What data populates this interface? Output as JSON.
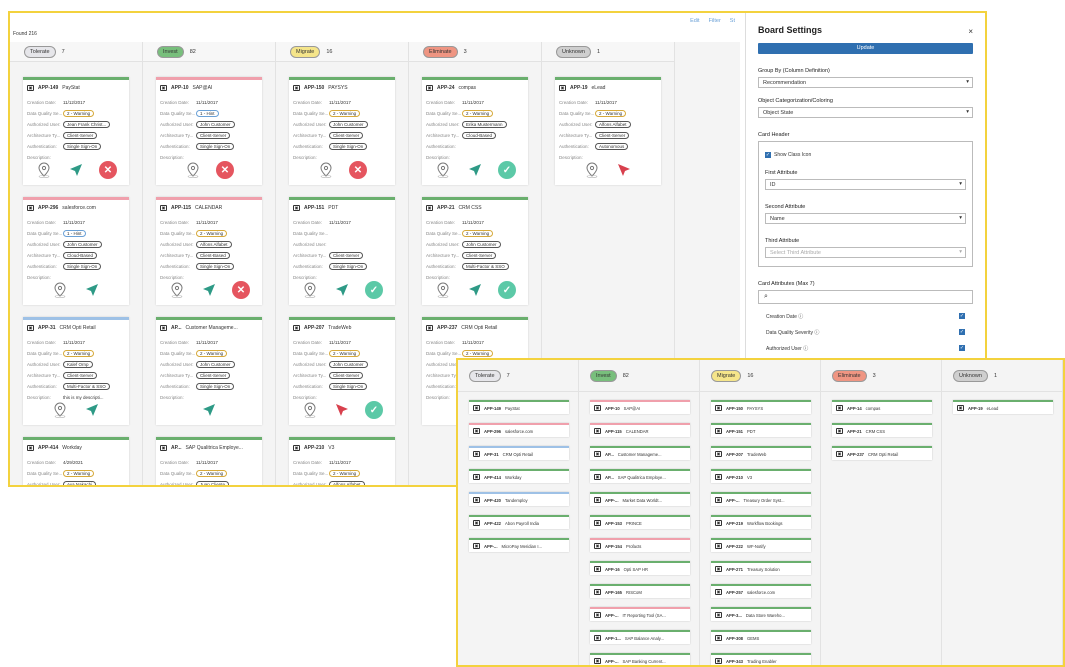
{
  "board": {
    "found": "Found 216",
    "actions": [
      "Edit",
      "Filter",
      "St"
    ],
    "columns": [
      {
        "name": "Tolerate",
        "count": "7",
        "color": "#e0e0e0"
      },
      {
        "name": "Invest",
        "count": "82",
        "color": "#6aaf6e"
      },
      {
        "name": "Migrate",
        "count": "16",
        "color": "#f3e27a"
      },
      {
        "name": "Eliminate",
        "count": "3",
        "color": "#ef8e7b"
      },
      {
        "name": "Unknown",
        "count": "1",
        "color": "#c9c9c9"
      }
    ],
    "labels": {
      "creation_date": "Creation Date:",
      "dq": "Data Quality Se...",
      "auth_user": "Authorized User:",
      "arch": "Architecture Ty...",
      "authn": "Authentication:",
      "desc": "Description:"
    }
  },
  "cards": [
    [
      {
        "id": "APP-149",
        "name": "PayStat",
        "date": "11/12/2017",
        "dq": "2 - Warning",
        "user": "Jean Frank Christ...",
        "arch": "Client-Server",
        "authn": "Single Sign-On",
        "desc": "",
        "btns": [
          "map",
          "arrow",
          "x"
        ]
      },
      {
        "id": "APP-296",
        "name": "salesforce.com",
        "date": "11/11/2017",
        "dq": "1 - Hint",
        "user": "John Customer",
        "arch": "Cloud-Based",
        "authn": "Single Sign-On",
        "desc": "",
        "btns": [
          "map",
          "arrow"
        ]
      },
      {
        "id": "APP-31",
        "name": "CRM Opti Retail",
        "date": "11/11/2017",
        "dq": "2 - Warning",
        "user": "Kalef Ornp",
        "arch": "Client-Server",
        "authn": "Multi-Factor & SSO",
        "desc": "this is my descripti...",
        "btns": [
          "map",
          "arrow"
        ]
      },
      {
        "id": "APP-414",
        "name": "Workday",
        "date": "4/29/2021",
        "dq": "2 - Warning",
        "user": "Aya Nakachi",
        "arch": "Cloud-Based",
        "authn": "",
        "desc": "",
        "btns": []
      }
    ],
    [
      {
        "id": "APP-10",
        "name": "SAP@AI",
        "date": "11/11/2017",
        "dq": "1 - Hint",
        "user": "John Customer",
        "arch": "Client-Server",
        "authn": "Single Sign-On",
        "desc": "",
        "btns": [
          "map",
          "x"
        ]
      },
      {
        "id": "APP-115",
        "name": "CALENDAR",
        "date": "11/11/2017",
        "dq": "2 - Warning",
        "user": "Alfons Alfabet",
        "arch": "Client-Based",
        "authn": "Single Sign-On",
        "desc": "",
        "btns": [
          "map",
          "arrow",
          "x"
        ]
      },
      {
        "id": "AP...",
        "name": "Customer Manageme...",
        "date": "11/11/2017",
        "dq": "2 - Warning",
        "user": "John Customer",
        "arch": "Client-Server",
        "authn": "Single Sign-On",
        "desc": "",
        "btns": [
          "arrow"
        ]
      },
      {
        "id": "AP...",
        "name": "SAP Qualitrica Employe...",
        "date": "11/11/2017",
        "dq": "2 - Warning",
        "user": "Juan Cliente",
        "arch": "Client-Server",
        "authn": "",
        "desc": "",
        "btns": []
      }
    ],
    [
      {
        "id": "APP-150",
        "name": "PAYSYS",
        "date": "11/11/2017",
        "dq": "2 - Warning",
        "user": "John Customer",
        "arch": "Client-Server",
        "authn": "Single Sign-On",
        "desc": "",
        "btns": [
          "map",
          "x"
        ]
      },
      {
        "id": "APP-151",
        "name": "PDT",
        "date": "11/11/2017",
        "dq": "",
        "user": "",
        "arch": "Client-Server",
        "authn": "Single Sign-On",
        "desc": "",
        "btns": [
          "map",
          "arrow",
          "check"
        ]
      },
      {
        "id": "APP-207",
        "name": "TradeWeb",
        "date": "11/11/2017",
        "dq": "2 - Warning",
        "user": "John Customer",
        "arch": "Client-Server",
        "authn": "Single Sign-On",
        "desc": "",
        "btns": [
          "map",
          "redarrow",
          "check"
        ]
      },
      {
        "id": "APP-210",
        "name": "V3",
        "date": "11/11/2017",
        "dq": "2 - Warning",
        "user": "Alfons Alfabet",
        "arch": "Client-Server",
        "authn": "",
        "desc": "",
        "btns": []
      }
    ],
    [
      {
        "id": "APP-24",
        "name": "compas",
        "date": "11/11/2017",
        "dq": "2 - Warning",
        "user": "Erika Mustermann",
        "arch": "Cloud-Based",
        "authn": "",
        "desc": "",
        "btns": [
          "map",
          "arrow",
          "check"
        ]
      },
      {
        "id": "APP-21",
        "name": "CRM CSS",
        "date": "11/11/2017",
        "dq": "2 - Warning",
        "user": "John Customer",
        "arch": "Client-Server",
        "authn": "Multi-Factor & SSO",
        "desc": "",
        "btns": [
          "map",
          "arrow",
          "check"
        ]
      },
      {
        "id": "APP-237",
        "name": "CRM Opti Retail",
        "date": "11/11/2017",
        "dq": "2 - Warning",
        "user": "Lisa Nyamba",
        "arch": "Client-Server",
        "authn": "",
        "desc": "",
        "btns": [
          "map"
        ]
      }
    ],
    [
      {
        "id": "APP-19",
        "name": "eLead",
        "date": "11/11/2017",
        "dq": "2 - Warning",
        "user": "Alfons Alfabet",
        "arch": "Client-Server",
        "authn": "Autonomous",
        "desc": "",
        "btns": [
          "map",
          "redarrow"
        ]
      }
    ]
  ],
  "settings": {
    "title": "Board Settings",
    "close": "×",
    "update": "Update",
    "group_by_label": "Group By (Column Definition)",
    "group_by_value": "Recommendation",
    "color_label": "Object Categorization/Coloring",
    "color_value": "Object State",
    "card_header_label": "Card Header",
    "show_class_icon": "Show Class Icon",
    "first_attr_label": "First Attribute",
    "first_attr_value": "ID",
    "second_attr_label": "Second Attribute",
    "second_attr_value": "Name",
    "third_attr_label": "Third Attribute",
    "third_attr_placeholder": "Select Third Attribute",
    "card_attrs_label": "Card Attributes (Max 7)",
    "card_attrs": [
      "Creation Date ⓘ",
      "Data Quality Severity ⓘ",
      "Authorized User ⓘ"
    ]
  },
  "compact": {
    "columns": [
      {
        "name": "Tolerate",
        "count": "7"
      },
      {
        "name": "Invest",
        "count": "82"
      },
      {
        "name": "Migrate",
        "count": "16"
      },
      {
        "name": "Eliminate",
        "count": "3"
      },
      {
        "name": "Unknown",
        "count": "1"
      }
    ],
    "cards": [
      [
        [
          "APP-149",
          "PayStat",
          "g"
        ],
        [
          "APP-296",
          "salesforce.com",
          "p"
        ],
        [
          "APP-31",
          "CRM Opti Retail",
          "b"
        ],
        [
          "APP-414",
          "Workday",
          "g"
        ],
        [
          "APP-420",
          "Tandemploy",
          "b"
        ],
        [
          "APP-422",
          "Abon Payroll India",
          "g"
        ],
        [
          "APP-...",
          "MicroPay Meridian I...",
          "g"
        ]
      ],
      [
        [
          "APP-10",
          "SAP@AI",
          "p"
        ],
        [
          "APP-115",
          "CALENDAR",
          "p"
        ],
        [
          "AP...",
          "Customer Manageme...",
          "g"
        ],
        [
          "AP...",
          "SAP Qualitrica Employe...",
          "g"
        ],
        [
          "APP-...",
          "Market Data Worldt...",
          "g"
        ],
        [
          "APP-153",
          "PRINCE",
          "g"
        ],
        [
          "APP-154",
          "Profacts",
          "p"
        ],
        [
          "APP-16",
          "Opti SAP HR",
          "g"
        ],
        [
          "APP-165",
          "RISCoM",
          "g"
        ],
        [
          "APP-...",
          "IT Reporting Tool (SA...",
          "p"
        ],
        [
          "APP-1...",
          "SAP Balance Analy...",
          "g"
        ],
        [
          "APP-...",
          "SAP Banking Current...",
          "g"
        ]
      ],
      [
        [
          "APP-150",
          "PAYSYS",
          "g"
        ],
        [
          "APP-151",
          "PDT",
          "g"
        ],
        [
          "APP-207",
          "TradeWeb",
          "g"
        ],
        [
          "APP-210",
          "V3",
          "g"
        ],
        [
          "APP-...",
          "Treasury Order Syst...",
          "g"
        ],
        [
          "APP-219",
          "Workflow Bookings",
          "g"
        ],
        [
          "APP-222",
          "WF-Notify",
          "g"
        ],
        [
          "APP-271",
          "Treasury Solution",
          "g"
        ],
        [
          "APP-257",
          "salesforce.com",
          "g"
        ],
        [
          "APP-3...",
          "Data Store Wareho...",
          "g"
        ],
        [
          "APP-308",
          "GEMS",
          "g"
        ],
        [
          "APP-343",
          "Trading Enabler",
          "g"
        ]
      ],
      [
        [
          "APP-14",
          "compas",
          "g"
        ],
        [
          "APP-21",
          "CRM CSS",
          "g"
        ],
        [
          "APP-237",
          "CRM Opti Retail",
          "g"
        ]
      ],
      [
        [
          "APP-19",
          "eLead",
          "g"
        ]
      ]
    ]
  }
}
